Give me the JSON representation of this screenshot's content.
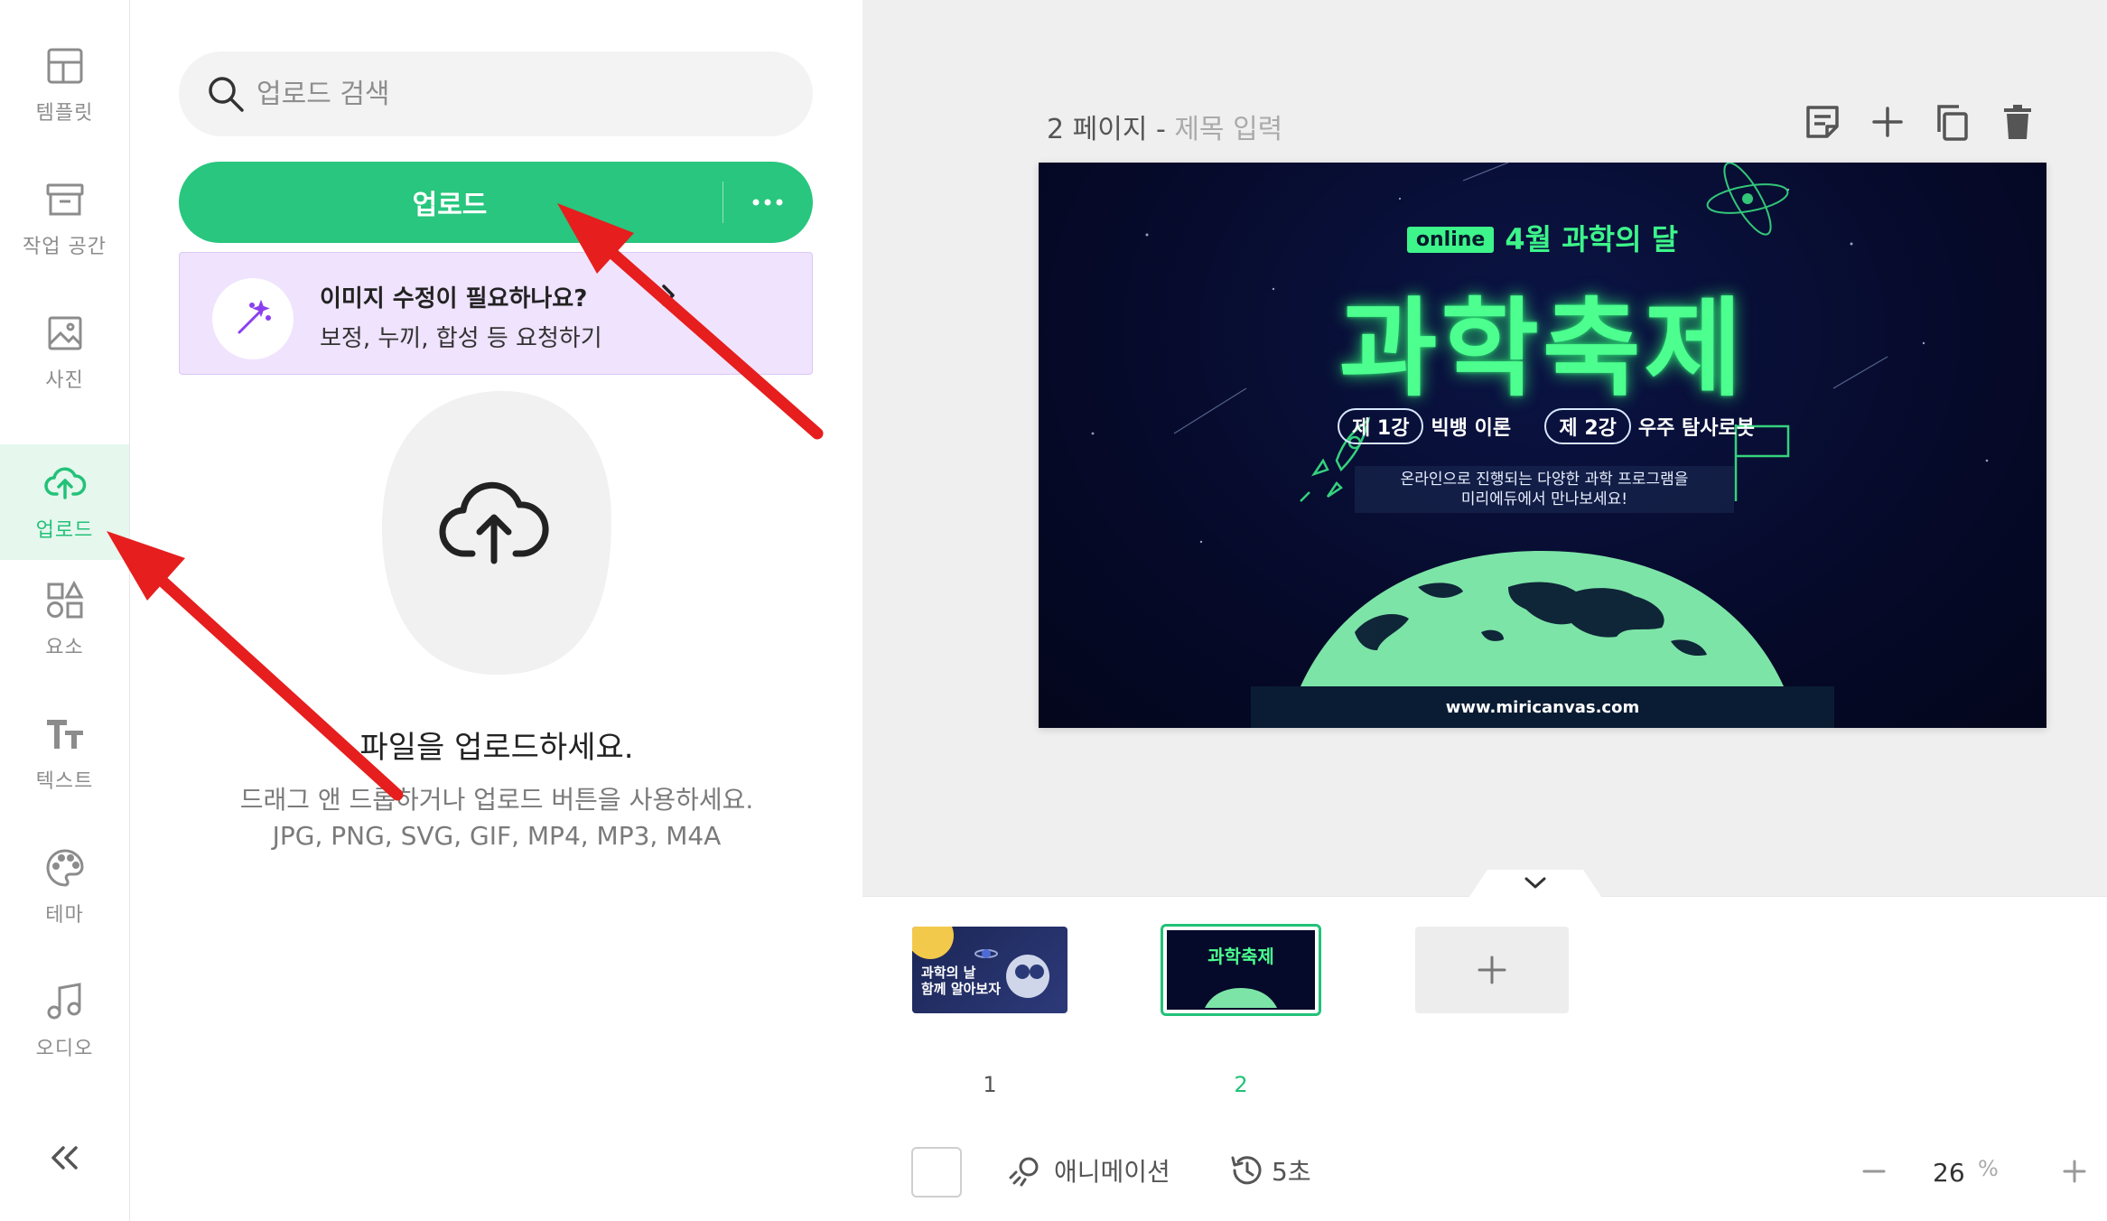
{
  "sidebar": {
    "items": [
      {
        "label": "템플릿",
        "icon": "template-icon"
      },
      {
        "label": "작업 공간",
        "icon": "workspace-icon"
      },
      {
        "label": "사진",
        "icon": "photo-icon"
      },
      {
        "label": "업로드",
        "icon": "cloud-upload-icon",
        "active": true
      },
      {
        "label": "요소",
        "icon": "elements-icon"
      },
      {
        "label": "텍스트",
        "icon": "text-icon"
      },
      {
        "label": "테마",
        "icon": "palette-icon"
      },
      {
        "label": "오디오",
        "icon": "music-note-icon"
      }
    ],
    "collapse_icon": "double-chevron-left-icon"
  },
  "panel": {
    "search": {
      "placeholder": "업로드 검색"
    },
    "upload_button": {
      "label": "업로드",
      "more_label": "···"
    },
    "edit_banner": {
      "title": "이미지 수정이 필요하나요?",
      "subtitle": "보정, 누끼, 합성 등 요청하기"
    },
    "empty_state": {
      "title": "파일을 업로드하세요.",
      "line1": "드래그 앤 드롭하거나 업로드 버튼을 사용하세요.",
      "line2": "JPG, PNG, SVG, GIF, MP4, MP3, M4A"
    }
  },
  "canvas": {
    "page_label": "2 페이지 - ",
    "title_placeholder": "제목 입력",
    "tools": [
      "note-icon",
      "plus-icon",
      "duplicate-icon",
      "trash-icon"
    ],
    "slide": {
      "online_badge": "online",
      "subtitle": "4월 과학의 달",
      "title": "과학축제",
      "lecture1_badge": "제 1강",
      "lecture1_name": "빅뱅 이론",
      "lecture2_badge": "제 2강",
      "lecture2_name": "우주 탐사로봇",
      "desc_line1": "온라인으로 진행되는 다양한 과학 프로그램을",
      "desc_line2": "미리에듀에서 만나보세요!",
      "url": "www.miricanvas.com"
    }
  },
  "filmstrip": {
    "pages": [
      {
        "num": "1",
        "text_line1": "과학의 날",
        "text_line2": "함께 알아보자"
      },
      {
        "num": "2",
        "text": "과학축제",
        "selected": true
      }
    ],
    "add_label": "+"
  },
  "bottom_bar": {
    "animation_label": "애니메이션",
    "duration_label": "5초",
    "zoom_value": "26",
    "zoom_unit": "%"
  },
  "colors": {
    "accent": "#22c278",
    "annotation_arrow": "#e61e1e",
    "banner_bg": "#efe3fd"
  }
}
